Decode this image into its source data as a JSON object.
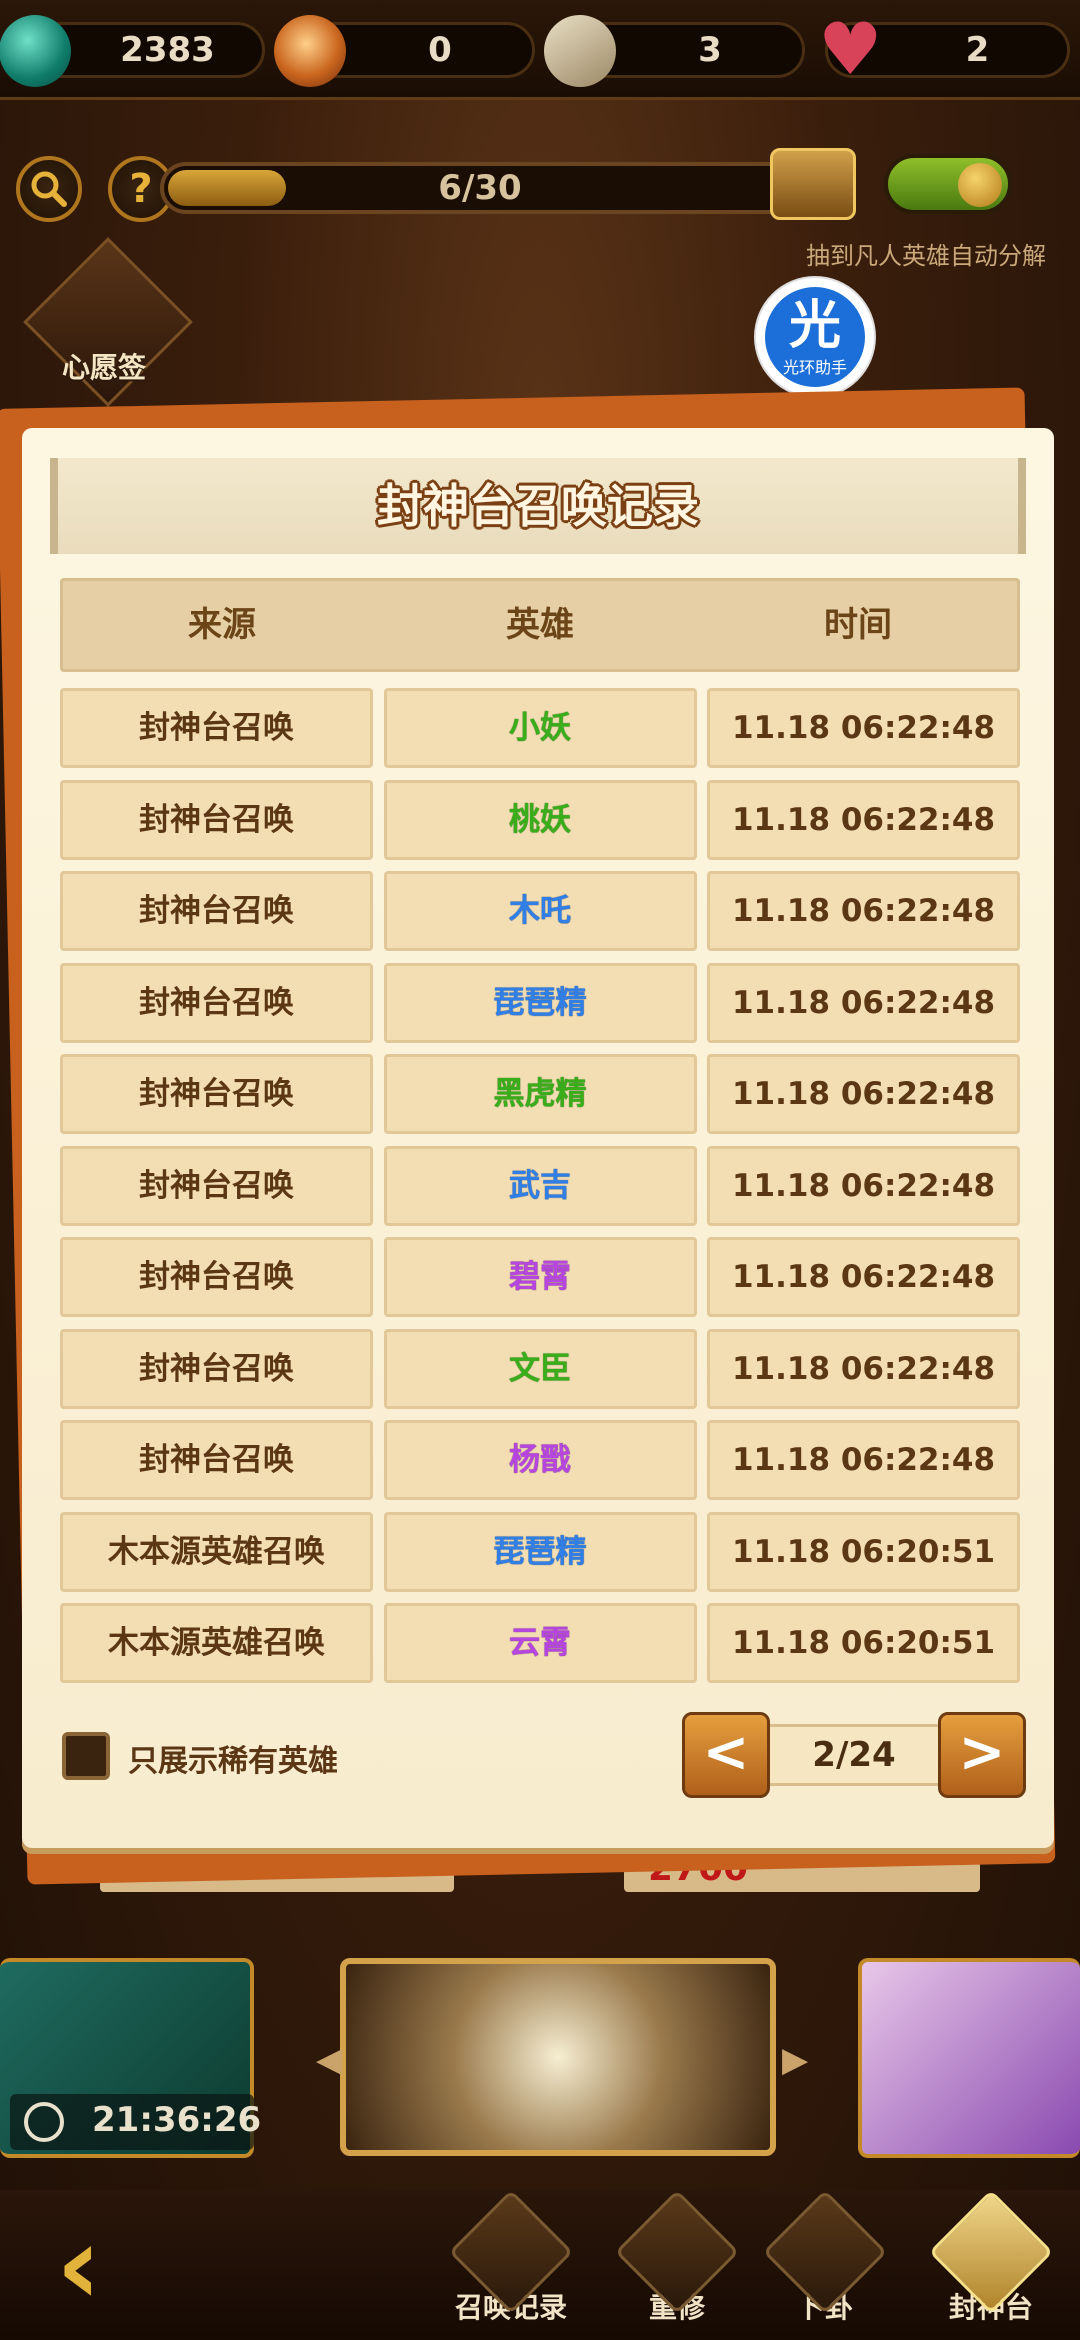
{
  "resources": {
    "jade": "2383",
    "bag": "0",
    "ticket": "3",
    "heart": "2"
  },
  "progress": {
    "text": "6/30",
    "fraction": 0.2
  },
  "auto_decompose_label": "抽到凡人英雄自动分解",
  "wish_label": "心愿签",
  "helper_badge": {
    "big": "光",
    "small": "光环助手"
  },
  "dialog": {
    "title": "封神台召唤记录",
    "headers": [
      "来源",
      "英雄",
      "时间"
    ],
    "rows": [
      {
        "source": "封神台召唤",
        "hero": "小妖",
        "time": "11.18 06:22:48",
        "rarity": "green"
      },
      {
        "source": "封神台召唤",
        "hero": "桃妖",
        "time": "11.18 06:22:48",
        "rarity": "green"
      },
      {
        "source": "封神台召唤",
        "hero": "木吒",
        "time": "11.18 06:22:48",
        "rarity": "blue"
      },
      {
        "source": "封神台召唤",
        "hero": "琵琶精",
        "time": "11.18 06:22:48",
        "rarity": "blue"
      },
      {
        "source": "封神台召唤",
        "hero": "黑虎精",
        "time": "11.18 06:22:48",
        "rarity": "green"
      },
      {
        "source": "封神台召唤",
        "hero": "武吉",
        "time": "11.18 06:22:48",
        "rarity": "blue"
      },
      {
        "source": "封神台召唤",
        "hero": "碧霄",
        "time": "11.18 06:22:48",
        "rarity": "purple"
      },
      {
        "source": "封神台召唤",
        "hero": "文臣",
        "time": "11.18 06:22:48",
        "rarity": "green"
      },
      {
        "source": "封神台召唤",
        "hero": "杨戬",
        "time": "11.18 06:22:48",
        "rarity": "purple"
      },
      {
        "source": "木本源英雄召唤",
        "hero": "琵琶精",
        "time": "11.18 06:20:51",
        "rarity": "blue"
      },
      {
        "source": "木本源英雄召唤",
        "hero": "云霄",
        "time": "11.18 06:20:51",
        "rarity": "purple"
      }
    ],
    "rare_only_label": "只展示稀有英雄",
    "pager": {
      "prev": "<",
      "current": "2/24",
      "next": ">"
    }
  },
  "bottom": {
    "cost_value": "2700",
    "timer": "21:36:26"
  },
  "nav": {
    "items": [
      "召唤记录",
      "重修",
      "卜卦",
      "封神台"
    ]
  },
  "colors": {
    "green": "#3aae1a",
    "blue": "#2f7fe6",
    "purple": "#b746e0"
  }
}
